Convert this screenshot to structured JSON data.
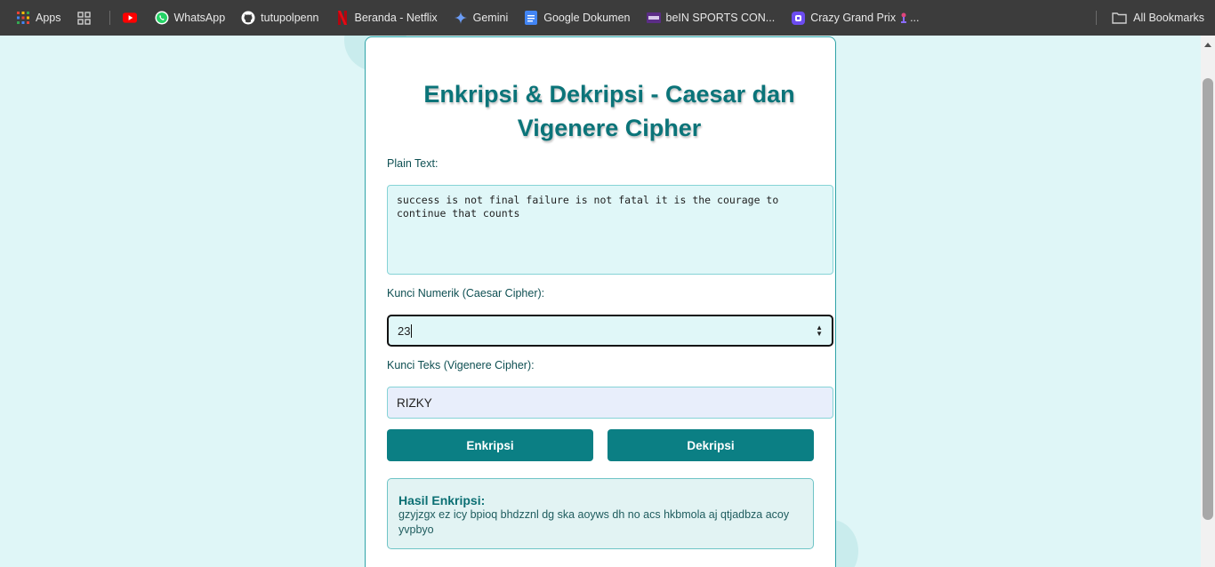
{
  "bookmarks": {
    "items": [
      {
        "label": "Apps",
        "icon": "apps-grid-icon"
      },
      {
        "label": "",
        "icon": "tab-groups-icon"
      },
      {
        "label": "",
        "icon": "youtube-icon"
      },
      {
        "label": "WhatsApp",
        "icon": "whatsapp-icon"
      },
      {
        "label": "tutupolpenn",
        "icon": "github-icon"
      },
      {
        "label": "Beranda - Netflix",
        "icon": "netflix-icon"
      },
      {
        "label": "Gemini",
        "icon": "gemini-icon"
      },
      {
        "label": "Google Dokumen",
        "icon": "google-docs-icon"
      },
      {
        "label": "beIN SPORTS CON...",
        "icon": "bein-sports-icon"
      },
      {
        "label": "Crazy Grand Prix",
        "icon": "crazy-grand-prix-icon"
      },
      {
        "label": "...",
        "icon": "game-icon"
      }
    ],
    "all_bookmarks": "All Bookmarks"
  },
  "form": {
    "title": "Enkripsi & Dekripsi - Caesar dan Vigenere Cipher",
    "plain_label": "Plain Text:",
    "plain_value": "success is not final failure is not fatal it is the courage to continue that counts",
    "caesar_label": "Kunci Numerik (Caesar Cipher):",
    "caesar_value": "23",
    "vigenere_label": "Kunci Teks (Vigenere Cipher):",
    "vigenere_value": "RIZKY",
    "encrypt_button": "Enkripsi",
    "decrypt_button": "Dekripsi"
  },
  "result": {
    "title": "Hasil Enkripsi:",
    "text": "gzyjzgx ez icy bpioq bhdzznl dg ska aoyws dh no acs hkbmola aj qtjadbza acoy yvpbyo"
  },
  "colors": {
    "accent": "#0b7f84",
    "page_bg": "#dff6f7",
    "title": "#0b7479"
  }
}
